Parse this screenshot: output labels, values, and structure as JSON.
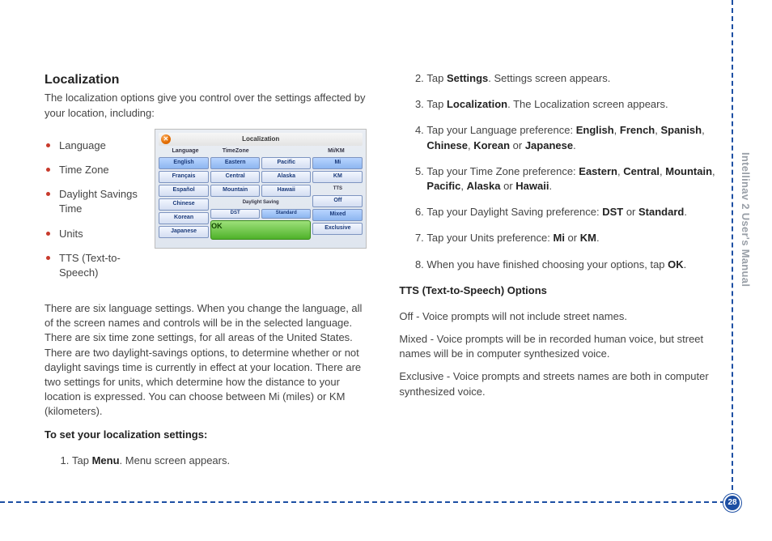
{
  "side_tab": "Intellinav 2 User's Manual",
  "page_number": "28",
  "left": {
    "title": "Localization",
    "intro": "The localization options give you control over the settings affected by your location, including:",
    "bullets": [
      "Language",
      "Time Zone",
      "Daylight Savings Time",
      "Units",
      "TTS (Text-to-Speech)"
    ],
    "figure": {
      "title": "Localization",
      "close_glyph": "✕",
      "headers": [
        "Language",
        "TimeZone",
        "",
        "Mi/KM"
      ],
      "col_language": [
        "English",
        "Français",
        "Español",
        "Chinese",
        "Korean",
        "Japanese"
      ],
      "col_tz1": [
        "Eastern",
        "Central",
        "Mountain"
      ],
      "col_tz2": [
        "Pacific",
        "Alaska",
        "Hawaii"
      ],
      "daylight_label": "Daylight Saving",
      "col_dst": [
        "DST",
        "Standard"
      ],
      "ok": "OK",
      "col_units": [
        "Mi",
        "KM",
        "TTS",
        "Off",
        "Mixed",
        "Exclusive"
      ]
    },
    "body": "There are six language settings. When you change the language, all of the screen names and controls will be in the selected language. There are six time zone settings, for all areas of the United States. There are two daylight-savings options, to determine whether or not daylight savings time is currently in effect at your location. There are two settings for units, which determine how the distance to your location is expressed. You can choose between Mi (miles) or KM (kilometers).",
    "set_heading": "To set your localization settings:",
    "step1_pre": "Tap ",
    "step1_bold": "Menu",
    "step1_post": ". Menu screen appears."
  },
  "right": {
    "steps": [
      {
        "pre": "Tap ",
        "b1": "Settings",
        "post": ". Settings screen appears."
      },
      {
        "pre": "Tap ",
        "b1": "Localization",
        "post": ". The Localization screen appears."
      },
      {
        "pre": "Tap your Language preference: ",
        "list": [
          "English",
          "French",
          "Spanish",
          "Chinese",
          "Korean"
        ],
        "last": "Japanese",
        "post": "."
      },
      {
        "pre": "Tap your Time Zone preference: ",
        "list": [
          "Eastern",
          "Central",
          "Mountain",
          "Pacific",
          "Alaska"
        ],
        "last": "Hawaii",
        "post": "."
      },
      {
        "pre": "Tap your Daylight Saving preference: ",
        "list": [
          "DST"
        ],
        "last": "Standard",
        "post": "."
      },
      {
        "pre": "Tap your Units preference: ",
        "list": [
          "Mi"
        ],
        "last": "KM",
        "post": "."
      },
      {
        "pre": "When you have finished choosing your options, tap ",
        "b1": "OK",
        "post": "."
      }
    ],
    "tts_heading": "TTS (Text-to-Speech) Options",
    "tts_off": "Off - Voice prompts will not include street names.",
    "tts_mixed": "Mixed - Voice prompts will be in recorded human voice, but street names will be in computer synthesized voice.",
    "tts_exclusive": "Exclusive - Voice prompts and streets names are both in computer synthesized voice."
  }
}
